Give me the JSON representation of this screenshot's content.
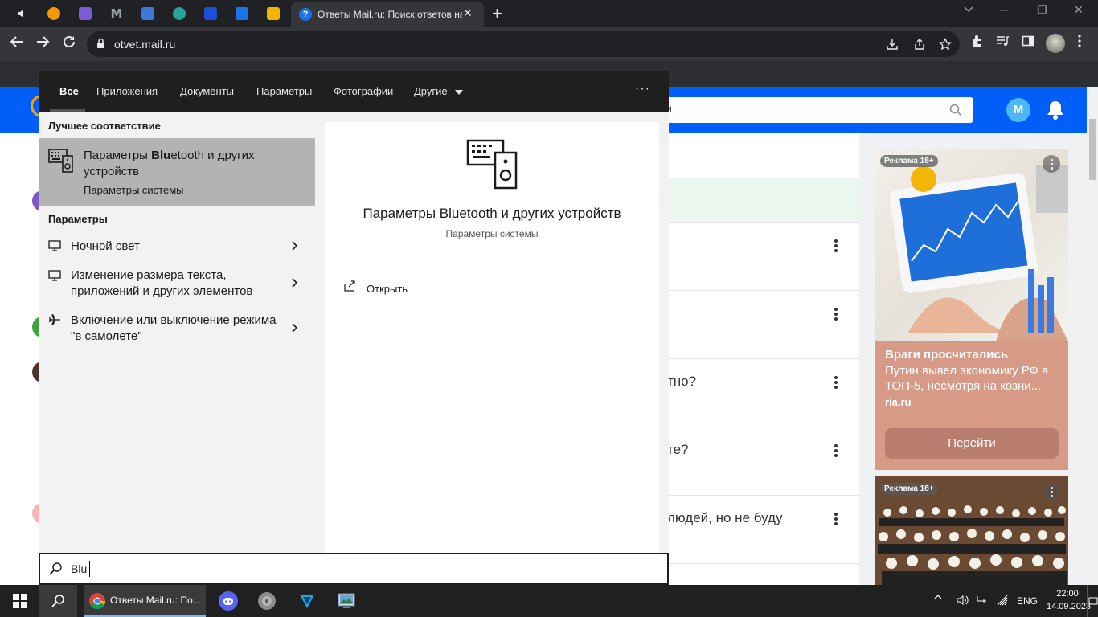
{
  "browser": {
    "active_tab_title": "Ответы Mail.ru: Поиск ответов на",
    "active_tab_favicon": "?",
    "new_tab_symbol": "+",
    "close_symbol": "✕",
    "url": "otvet.mail.ru",
    "window_controls": [
      "─",
      "❐",
      "✕"
    ]
  },
  "site": {
    "avatar_letter": "M",
    "questions": [
      {
        "text": "тно?"
      },
      {
        "text": "те?"
      },
      {
        "text": "людей, но не буду"
      }
    ],
    "ads": [
      {
        "badge": "Реклама 18+",
        "headline": "Враги просчитались",
        "description": "Путин вывел экономику РФ в ТОП-5, несмотря на козни...",
        "source": "ria.ru",
        "button": "Перейти"
      },
      {
        "badge": "Реклама 18+"
      }
    ]
  },
  "search": {
    "tabs": [
      "Все",
      "Приложения",
      "Документы",
      "Параметры",
      "Фотографии",
      "Другие"
    ],
    "more_symbol": "···",
    "best_match_header": "Лучшее соответствие",
    "best_match": {
      "title_prefix": "Параметры ",
      "title_bold": "Blu",
      "title_suffix": "etooth и других устройств",
      "subtitle": "Параметры системы"
    },
    "settings_header": "Параметры",
    "settings_items": [
      {
        "label": "Ночной свет"
      },
      {
        "label": "Изменение размера текста, приложений и других элементов"
      },
      {
        "label": "Включение или выключение режима \"в самолете\""
      }
    ],
    "preview": {
      "title": "Параметры Bluetooth и других устройств",
      "subtitle": "Параметры системы",
      "open_label": "Открыть"
    },
    "query": "Blu"
  },
  "taskbar": {
    "chrome_label": "Ответы Mail.ru: По...",
    "language": "ENG",
    "time": "22:00",
    "date": "14.09.2023"
  },
  "colors": {
    "mail_blue": "#005ff9",
    "search_dark": "#1f1f1f",
    "best_match_bg": "#b3b3b3",
    "ad_bg": "#d69a87",
    "taskbar": "#202020"
  }
}
